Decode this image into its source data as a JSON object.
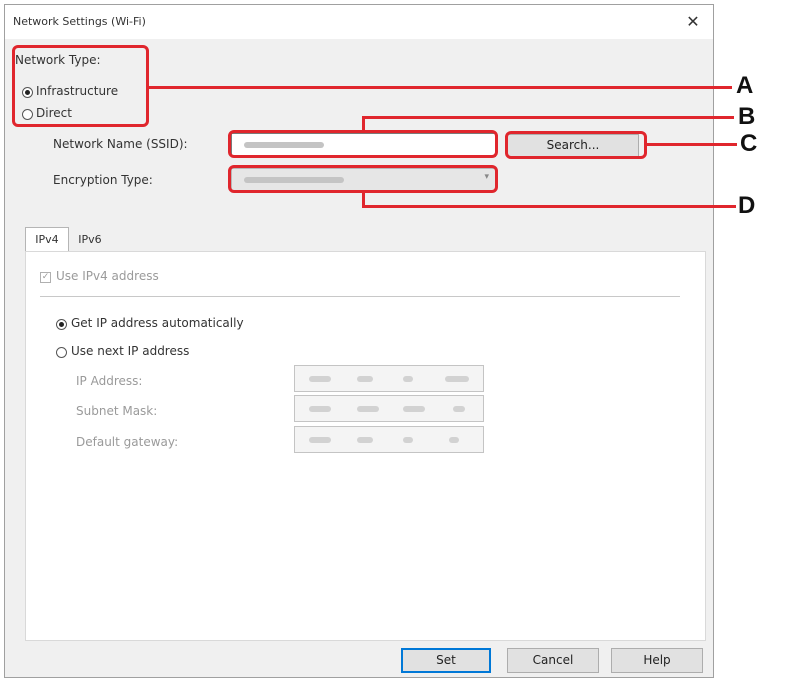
{
  "window": {
    "title": "Network Settings (Wi-Fi)",
    "close_glyph": "✕"
  },
  "network_type": {
    "label": "Network Type:",
    "options": [
      {
        "label": "Infrastructure",
        "selected": true
      },
      {
        "label": "Direct",
        "selected": false
      }
    ]
  },
  "ssid": {
    "label": "Network Name (SSID):"
  },
  "search_button": {
    "label": "Search..."
  },
  "encryption": {
    "label": "Encryption Type:"
  },
  "tabs": [
    {
      "label": "IPv4",
      "active": true
    },
    {
      "label": "IPv6",
      "active": false
    }
  ],
  "ipv4": {
    "use_ipv4_label": "Use IPv4 address",
    "use_ipv4_checked": true,
    "auto_label": "Get IP address automatically",
    "auto_selected": true,
    "manual_label": "Use next IP address",
    "manual_selected": false,
    "fields": [
      {
        "label": "IP Address:"
      },
      {
        "label": "Subnet Mask:"
      },
      {
        "label": "Default gateway:"
      }
    ]
  },
  "buttons": {
    "set": "Set",
    "cancel": "Cancel",
    "help": "Help"
  },
  "callouts": {
    "a": "A",
    "b": "B",
    "c": "C",
    "d": "D",
    "color": "#e0262d"
  }
}
